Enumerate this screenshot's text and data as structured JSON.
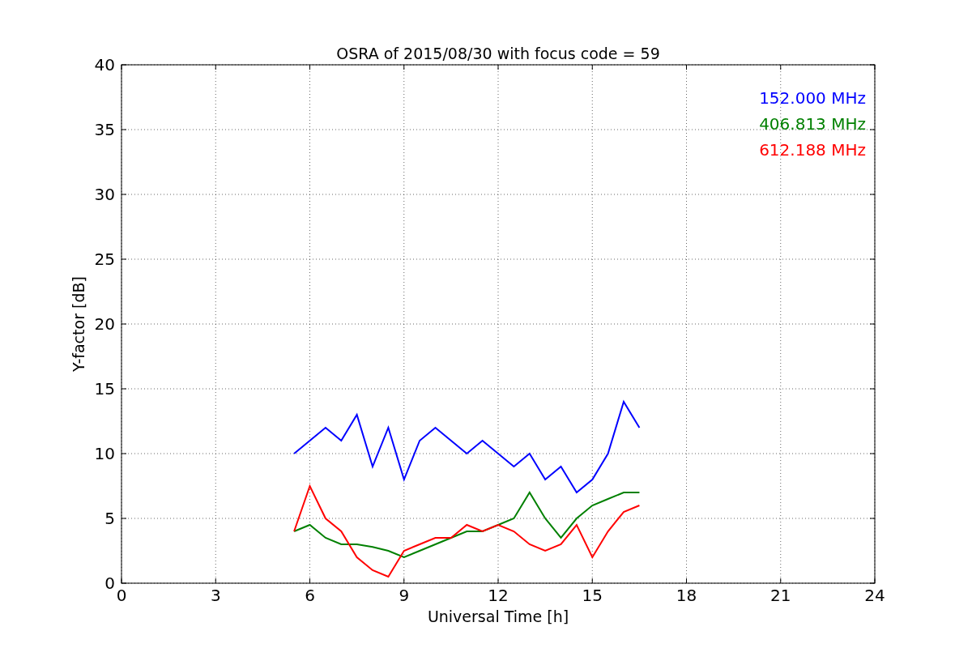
{
  "figure": {
    "chart_data": {
      "type": "line",
      "title": "OSRA of 2015/08/30 with focus code = 59",
      "xlabel": "Universal Time [h]",
      "ylabel": "Y-factor [dB]",
      "x": [
        5.5,
        6,
        6.5,
        7,
        7.5,
        8,
        8.5,
        9,
        9.5,
        10,
        10.5,
        11,
        11.5,
        12,
        12.5,
        13,
        13.5,
        14,
        14.5,
        15,
        15.5,
        16,
        16.5
      ],
      "series": [
        {
          "name": "152.000 MHz",
          "color": "#0000ff",
          "values": [
            10,
            11,
            12,
            11,
            13,
            9,
            12,
            8,
            11,
            12,
            11,
            10,
            11,
            10,
            9,
            10,
            8,
            9,
            7,
            8,
            10,
            14,
            12
          ]
        },
        {
          "name": "406.813 MHz",
          "color": "#008000",
          "values": [
            4,
            4.5,
            3.5,
            3,
            3,
            2.8,
            2.5,
            2,
            2.5,
            3,
            3.5,
            4,
            4,
            4.5,
            5,
            7,
            5,
            3.5,
            5,
            6,
            6.5,
            7,
            7
          ]
        },
        {
          "name": "612.188 MHz",
          "color": "#ff0000",
          "values": [
            4,
            7.5,
            5,
            4,
            2,
            1,
            0.5,
            2.5,
            3,
            3.5,
            3.5,
            4.5,
            4,
            4.5,
            4,
            3,
            2.5,
            3,
            4.5,
            2,
            4,
            5.5,
            6
          ]
        }
      ],
      "grid": true,
      "xlim": [
        0,
        24
      ],
      "ylim": [
        0,
        40
      ],
      "xticks": [
        0,
        3,
        6,
        9,
        12,
        15,
        18,
        21,
        24
      ],
      "yticks": [
        0,
        5,
        10,
        15,
        20,
        25,
        30,
        35,
        40
      ]
    }
  }
}
